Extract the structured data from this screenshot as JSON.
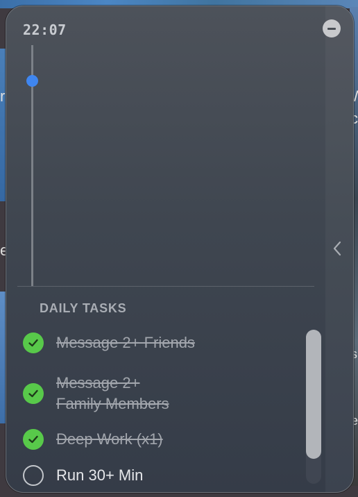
{
  "widget": {
    "time": "22:07",
    "section_title": "DAILY TASKS",
    "accent_color": "#3f86f0",
    "done_color": "#58c94a"
  },
  "tasks": [
    {
      "label": "Message 2+ Friends",
      "done": true
    },
    {
      "label": "Message 2+\nFamily Members",
      "done": true
    },
    {
      "label": "Deep Work (x1)",
      "done": true
    },
    {
      "label": "Run 30+ Min",
      "done": false
    }
  ],
  "background_edge_text": [
    "r",
    "e",
    "W",
    "c",
    "s",
    "e"
  ]
}
